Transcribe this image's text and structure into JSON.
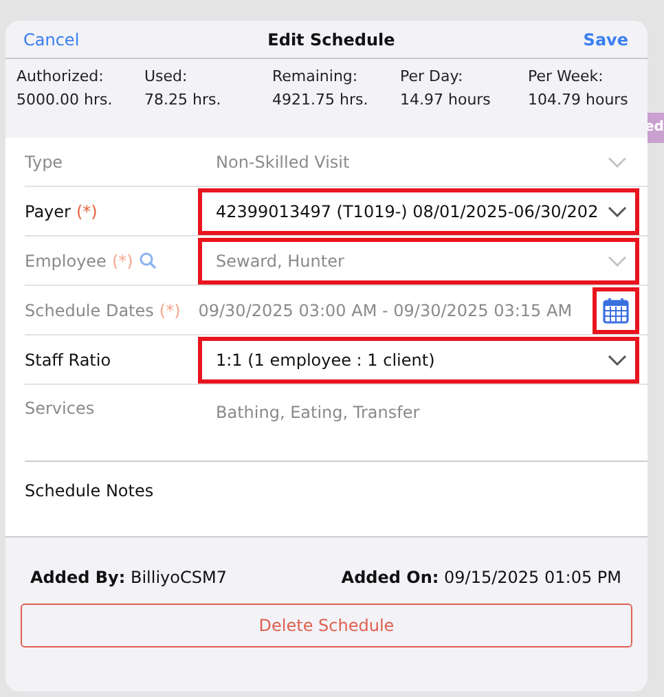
{
  "background": {
    "chip": "ed"
  },
  "header": {
    "cancel": "Cancel",
    "title": "Edit Schedule",
    "save": "Save"
  },
  "stats": [
    {
      "label": "Authorized:",
      "value": "5000.00 hrs."
    },
    {
      "label": "Used:",
      "value": "78.25 hrs."
    },
    {
      "label": "Remaining:",
      "value": "4921.75 hrs."
    },
    {
      "label": "Per Day:",
      "value": "14.97 hours"
    },
    {
      "label": "Per Week:",
      "value": "104.79 hours"
    }
  ],
  "fields": [
    {
      "kind": "select",
      "label": "Type",
      "value": "Non-Skilled Visit",
      "required": false,
      "disabled": true,
      "highlighted": false,
      "search": false
    },
    {
      "kind": "select",
      "label": "Payer",
      "value": "42399013497 (T1019-) 08/01/2025-06/30/202",
      "required": true,
      "required_mark": "(*)",
      "disabled": false,
      "highlighted": true,
      "search": false
    },
    {
      "kind": "select",
      "label": "Employee",
      "value": "Seward, Hunter",
      "required": true,
      "required_mark": "(*)",
      "disabled": true,
      "highlighted": true,
      "search": true
    },
    {
      "kind": "date",
      "label": "Schedule Dates",
      "value": "09/30/2025 03:00 AM - 09/30/2025 03:15 AM",
      "required": true,
      "required_mark": "(*)",
      "disabled": true,
      "highlighted": true,
      "search": false
    },
    {
      "kind": "select",
      "label": "Staff Ratio",
      "value": "1:1 (1 employee : 1 client)",
      "required": false,
      "disabled": false,
      "highlighted": true,
      "search": false
    },
    {
      "kind": "text",
      "label": "Services",
      "value": "Bathing, Eating, Transfer",
      "required": false,
      "disabled": true,
      "highlighted": false,
      "search": false
    }
  ],
  "notes": {
    "label": "Schedule Notes"
  },
  "footer": {
    "added_by_label": "Added By:",
    "added_by": "BilliyoCSM7",
    "added_on_label": "Added On:",
    "added_on": "09/15/2025 01:05 PM",
    "delete": "Delete Schedule"
  }
}
